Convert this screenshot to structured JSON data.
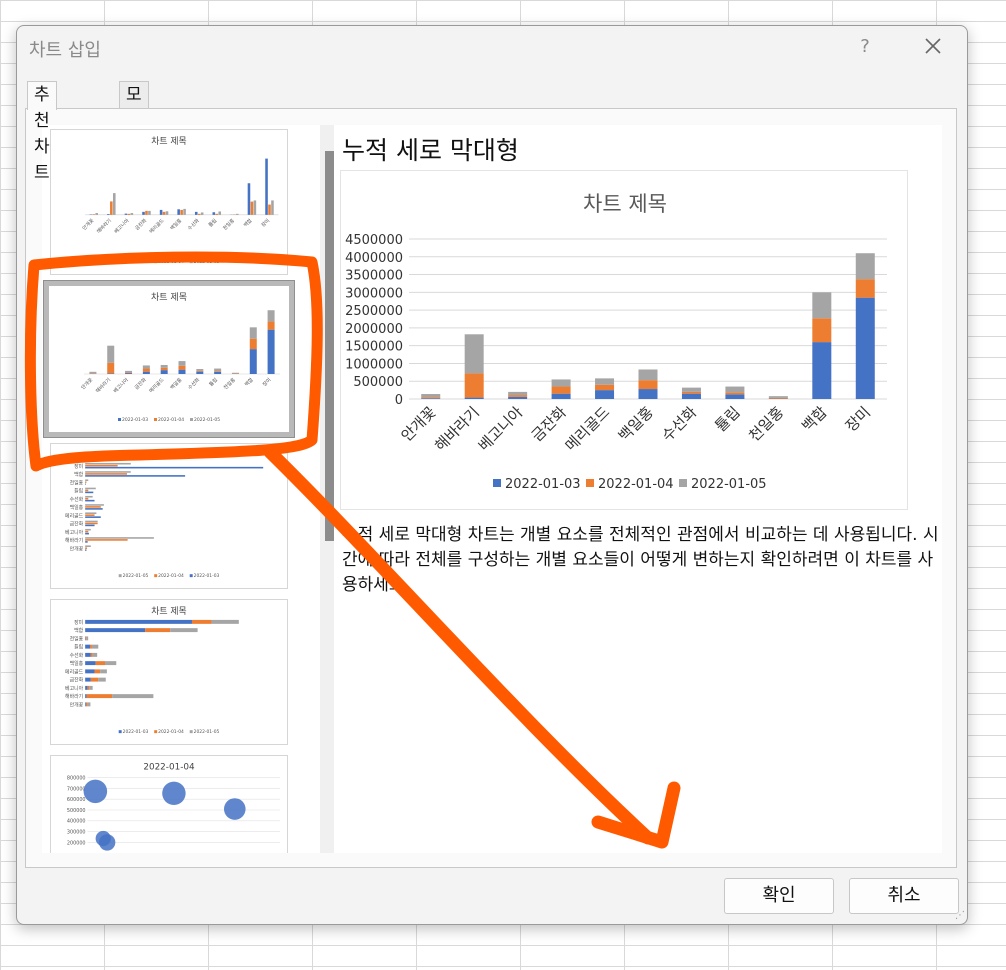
{
  "dialog": {
    "title": "차트 삽입",
    "help_label": "?",
    "ok_label": "확인",
    "cancel_label": "취소"
  },
  "tabs": [
    {
      "label": "추천 차트",
      "active": true
    },
    {
      "label": "모든 차트",
      "active": false
    }
  ],
  "thumbnails": [
    {
      "title": "차트 제목",
      "type": "clustered-column"
    },
    {
      "title": "차트 제목",
      "type": "stacked-column",
      "selected": true
    },
    {
      "title": "차트 제목",
      "type": "clustered-bar"
    },
    {
      "title": "차트 제목",
      "type": "stacked-bar"
    },
    {
      "title": "2022-01-04",
      "type": "bubble",
      "y_ticks": [
        "800000",
        "700000",
        "600000",
        "500000",
        "400000",
        "300000",
        "200000"
      ]
    }
  ],
  "thumbnail_legends": {
    "column": [
      "2022-01-03",
      "2022-01-04",
      "2022-01-05"
    ],
    "bar": [
      "2022-01-05",
      "2022-01-04",
      "2022-01-03"
    ]
  },
  "preview": {
    "chart_name": "누적 세로 막대형",
    "description": "누적 세로 막대형 차트는 개별 요소를 전체적인 관점에서 비교하는 데 사용됩니다. 시간에 따라 전체를 구성하는 개별 요소들이 어떻게 변하는지 확인하려면 이 차트를 사용하세요."
  },
  "colors": {
    "series1": "#4472c4",
    "series2": "#ed7d31",
    "series3": "#a5a5a5",
    "annotation": "#ff5a00"
  },
  "chart_data": {
    "type": "bar",
    "stacked": true,
    "title": "차트 제목",
    "categories": [
      "안개꽃",
      "해바라기",
      "베고니아",
      "금잔화",
      "메리골드",
      "백일홍",
      "수선화",
      "튤립",
      "천일홍",
      "백합",
      "장미"
    ],
    "series": [
      {
        "name": "2022-01-03",
        "values": [
          20000,
          40000,
          60000,
          150000,
          250000,
          280000,
          150000,
          130000,
          10000,
          1600000,
          2850000
        ]
      },
      {
        "name": "2022-01-04",
        "values": [
          30000,
          680000,
          50000,
          200000,
          150000,
          250000,
          50000,
          50000,
          20000,
          670000,
          520000
        ]
      },
      {
        "name": "2022-01-05",
        "values": [
          90000,
          1100000,
          90000,
          200000,
          180000,
          300000,
          120000,
          170000,
          50000,
          730000,
          730000
        ]
      }
    ],
    "y_ticks": [
      "4500000",
      "4000000",
      "3500000",
      "3000000",
      "2500000",
      "2000000",
      "1500000",
      "1000000",
      "500000",
      "0"
    ],
    "ylim": [
      0,
      4500000
    ],
    "legend_position": "bottom",
    "grid": true
  }
}
